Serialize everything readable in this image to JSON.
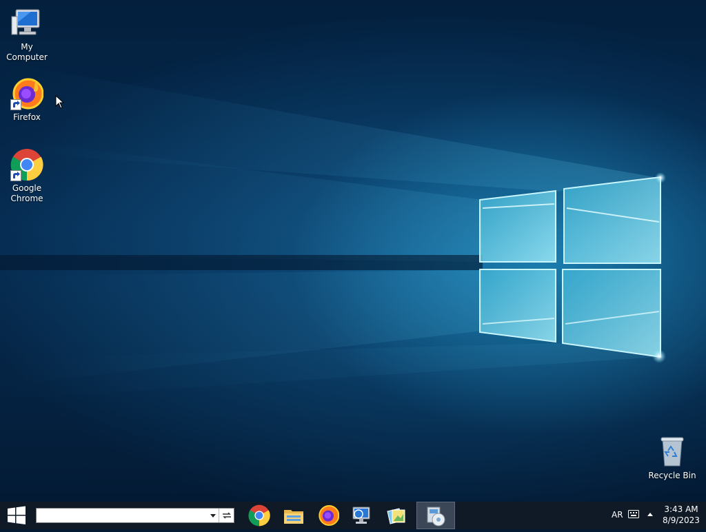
{
  "desktop": {
    "icons": [
      {
        "label": "My Computer",
        "icon": "computer-icon"
      },
      {
        "label": "Firefox",
        "icon": "firefox-icon"
      },
      {
        "label": "Google Chrome",
        "icon": "chrome-icon"
      },
      {
        "label": "Recycle Bin",
        "icon": "recycle-bin-icon"
      }
    ]
  },
  "taskbar": {
    "search": {
      "value": "",
      "placeholder": ""
    },
    "pinned": [
      {
        "icon": "chrome-icon"
      },
      {
        "icon": "file-explorer-icon"
      },
      {
        "icon": "firefox-icon"
      },
      {
        "icon": "network-computer-icon"
      },
      {
        "icon": "photos-icon"
      },
      {
        "icon": "media-installer-icon",
        "active": true
      }
    ],
    "tray": {
      "language": "AR",
      "time": "3:43 AM",
      "date": "8/9/2023"
    }
  },
  "colors": {
    "taskbar_bg": "#101a26",
    "wallpaper_blue": "#0a5a8a",
    "window_glow": "#7fe6ff"
  }
}
